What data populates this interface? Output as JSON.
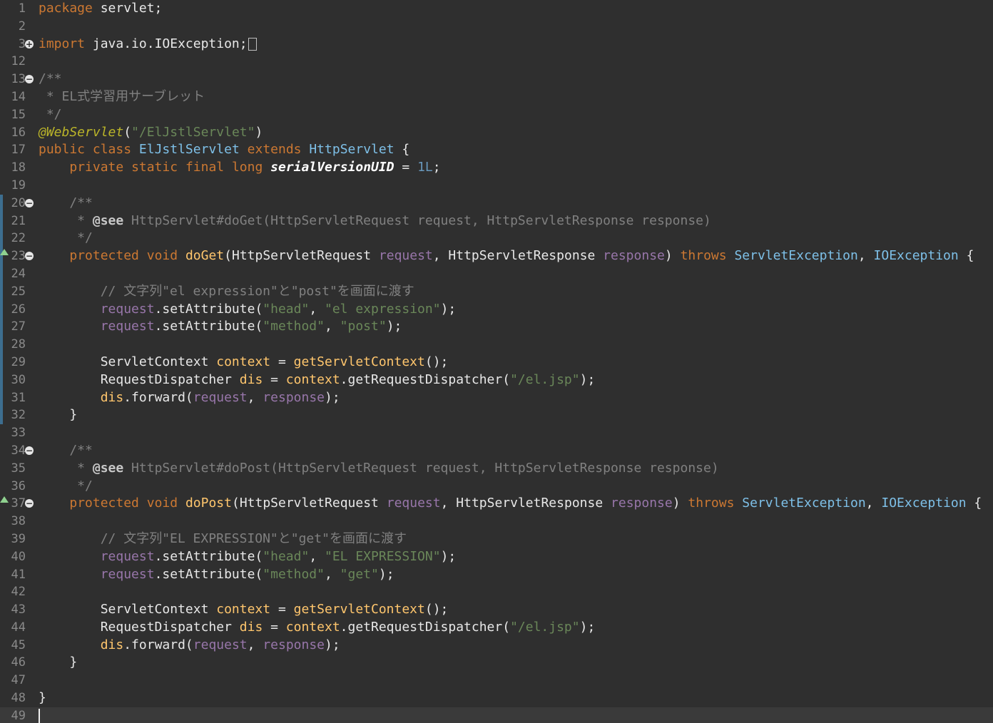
{
  "editor": {
    "lines": [
      {
        "n": "1",
        "tokens": [
          {
            "t": "package",
            "c": "kw"
          },
          {
            "t": " servlet;",
            "c": "plain"
          }
        ]
      },
      {
        "n": "2",
        "tokens": []
      },
      {
        "n": "3",
        "fold": "+",
        "tokens": [
          {
            "t": "import",
            "c": "kw"
          },
          {
            "t": " java.io.IOException;",
            "c": "plain"
          }
        ],
        "folded": true
      },
      {
        "n": "12",
        "tokens": []
      },
      {
        "n": "13",
        "fold": "-",
        "tokens": [
          {
            "t": "/**",
            "c": "cmt"
          }
        ]
      },
      {
        "n": "14",
        "tokens": [
          {
            "t": " * EL式学習用サーブレット",
            "c": "cmt"
          }
        ]
      },
      {
        "n": "15",
        "tokens": [
          {
            "t": " */",
            "c": "cmt"
          }
        ]
      },
      {
        "n": "16",
        "tokens": [
          {
            "t": "@WebServlet",
            "c": "ann"
          },
          {
            "t": "(",
            "c": "plain"
          },
          {
            "t": "\"/ElJstlServlet\"",
            "c": "str"
          },
          {
            "t": ")",
            "c": "plain"
          }
        ]
      },
      {
        "n": "17",
        "tokens": [
          {
            "t": "public",
            "c": "kw"
          },
          {
            "t": " ",
            "c": "plain"
          },
          {
            "t": "class",
            "c": "kw"
          },
          {
            "t": " ",
            "c": "plain"
          },
          {
            "t": "ElJstlServlet",
            "c": "type"
          },
          {
            "t": " ",
            "c": "plain"
          },
          {
            "t": "extends",
            "c": "kw"
          },
          {
            "t": " ",
            "c": "plain"
          },
          {
            "t": "HttpServlet",
            "c": "type"
          },
          {
            "t": " {",
            "c": "plain"
          }
        ]
      },
      {
        "n": "18",
        "tokens": [
          {
            "t": "    ",
            "c": "plain"
          },
          {
            "t": "private",
            "c": "kw"
          },
          {
            "t": " ",
            "c": "plain"
          },
          {
            "t": "static",
            "c": "kw"
          },
          {
            "t": " ",
            "c": "plain"
          },
          {
            "t": "final",
            "c": "kw"
          },
          {
            "t": " ",
            "c": "plain"
          },
          {
            "t": "long",
            "c": "kw"
          },
          {
            "t": " ",
            "c": "plain"
          },
          {
            "t": "serialVersionUID",
            "c": "fld"
          },
          {
            "t": " = ",
            "c": "plain"
          },
          {
            "t": "1L",
            "c": "num"
          },
          {
            "t": ";",
            "c": "plain"
          }
        ]
      },
      {
        "n": "19",
        "tokens": []
      },
      {
        "n": "20",
        "fold": "-",
        "changed": true,
        "tokens": [
          {
            "t": "    /**",
            "c": "cmt"
          }
        ]
      },
      {
        "n": "21",
        "changed": true,
        "tokens": [
          {
            "t": "     * ",
            "c": "cmt"
          },
          {
            "t": "@see",
            "c": "tag"
          },
          {
            "t": " HttpServlet#doGet(HttpServletRequest request, HttpServletResponse response)",
            "c": "cmt"
          }
        ]
      },
      {
        "n": "22",
        "changed": true,
        "tokens": [
          {
            "t": "     */",
            "c": "cmt"
          }
        ]
      },
      {
        "n": "23",
        "fold": "-",
        "override": true,
        "changed": true,
        "tokens": [
          {
            "t": "    ",
            "c": "plain"
          },
          {
            "t": "protected",
            "c": "kw"
          },
          {
            "t": " ",
            "c": "plain"
          },
          {
            "t": "void",
            "c": "kw"
          },
          {
            "t": " ",
            "c": "plain"
          },
          {
            "t": "doGet",
            "c": "meth"
          },
          {
            "t": "(HttpServletRequest ",
            "c": "plain"
          },
          {
            "t": "request",
            "c": "var"
          },
          {
            "t": ", HttpServletResponse ",
            "c": "plain"
          },
          {
            "t": "response",
            "c": "var"
          },
          {
            "t": ") ",
            "c": "plain"
          },
          {
            "t": "throws",
            "c": "kw"
          },
          {
            "t": " ",
            "c": "plain"
          },
          {
            "t": "ServletException",
            "c": "type"
          },
          {
            "t": ", ",
            "c": "plain"
          },
          {
            "t": "IOException",
            "c": "type"
          },
          {
            "t": " {",
            "c": "plain"
          }
        ]
      },
      {
        "n": "24",
        "changed": true,
        "tokens": []
      },
      {
        "n": "25",
        "changed": true,
        "tokens": [
          {
            "t": "        // 文字列\"el expression\"と\"post\"を画面に渡す",
            "c": "cmt"
          }
        ]
      },
      {
        "n": "26",
        "changed": true,
        "tokens": [
          {
            "t": "        ",
            "c": "plain"
          },
          {
            "t": "request",
            "c": "var"
          },
          {
            "t": ".setAttribute(",
            "c": "plain"
          },
          {
            "t": "\"head\"",
            "c": "str"
          },
          {
            "t": ", ",
            "c": "plain"
          },
          {
            "t": "\"el expression\"",
            "c": "str"
          },
          {
            "t": ");",
            "c": "plain"
          }
        ]
      },
      {
        "n": "27",
        "changed": true,
        "tokens": [
          {
            "t": "        ",
            "c": "plain"
          },
          {
            "t": "request",
            "c": "var"
          },
          {
            "t": ".setAttribute(",
            "c": "plain"
          },
          {
            "t": "\"method\"",
            "c": "str"
          },
          {
            "t": ", ",
            "c": "plain"
          },
          {
            "t": "\"post\"",
            "c": "str"
          },
          {
            "t": ");",
            "c": "plain"
          }
        ]
      },
      {
        "n": "28",
        "changed": true,
        "tokens": []
      },
      {
        "n": "29",
        "changed": true,
        "tokens": [
          {
            "t": "        ServletContext ",
            "c": "plain"
          },
          {
            "t": "context",
            "c": "meth"
          },
          {
            "t": " = ",
            "c": "plain"
          },
          {
            "t": "getServletContext",
            "c": "meth"
          },
          {
            "t": "();",
            "c": "plain"
          }
        ]
      },
      {
        "n": "30",
        "changed": true,
        "tokens": [
          {
            "t": "        RequestDispatcher ",
            "c": "plain"
          },
          {
            "t": "dis",
            "c": "meth"
          },
          {
            "t": " = ",
            "c": "plain"
          },
          {
            "t": "context",
            "c": "meth"
          },
          {
            "t": ".getRequestDispatcher(",
            "c": "plain"
          },
          {
            "t": "\"/el.jsp\"",
            "c": "str"
          },
          {
            "t": ");",
            "c": "plain"
          }
        ]
      },
      {
        "n": "31",
        "changed": true,
        "tokens": [
          {
            "t": "        ",
            "c": "plain"
          },
          {
            "t": "dis",
            "c": "meth"
          },
          {
            "t": ".forward(",
            "c": "plain"
          },
          {
            "t": "request",
            "c": "var"
          },
          {
            "t": ", ",
            "c": "plain"
          },
          {
            "t": "response",
            "c": "var"
          },
          {
            "t": ");",
            "c": "plain"
          }
        ]
      },
      {
        "n": "32",
        "changed": true,
        "tokens": [
          {
            "t": "    }",
            "c": "plain"
          }
        ]
      },
      {
        "n": "33",
        "tokens": []
      },
      {
        "n": "34",
        "fold": "-",
        "tokens": [
          {
            "t": "    /**",
            "c": "cmt"
          }
        ]
      },
      {
        "n": "35",
        "tokens": [
          {
            "t": "     * ",
            "c": "cmt"
          },
          {
            "t": "@see",
            "c": "tag"
          },
          {
            "t": " HttpServlet#doPost(HttpServletRequest request, HttpServletResponse response)",
            "c": "cmt"
          }
        ]
      },
      {
        "n": "36",
        "tokens": [
          {
            "t": "     */",
            "c": "cmt"
          }
        ]
      },
      {
        "n": "37",
        "fold": "-",
        "override": true,
        "tokens": [
          {
            "t": "    ",
            "c": "plain"
          },
          {
            "t": "protected",
            "c": "kw"
          },
          {
            "t": " ",
            "c": "plain"
          },
          {
            "t": "void",
            "c": "kw"
          },
          {
            "t": " ",
            "c": "plain"
          },
          {
            "t": "doPost",
            "c": "meth"
          },
          {
            "t": "(HttpServletRequest ",
            "c": "plain"
          },
          {
            "t": "request",
            "c": "var"
          },
          {
            "t": ", HttpServletResponse ",
            "c": "plain"
          },
          {
            "t": "response",
            "c": "var"
          },
          {
            "t": ") ",
            "c": "plain"
          },
          {
            "t": "throws",
            "c": "kw"
          },
          {
            "t": " ",
            "c": "plain"
          },
          {
            "t": "ServletException",
            "c": "type"
          },
          {
            "t": ", ",
            "c": "plain"
          },
          {
            "t": "IOException",
            "c": "type"
          },
          {
            "t": " {",
            "c": "plain"
          }
        ]
      },
      {
        "n": "38",
        "tokens": []
      },
      {
        "n": "39",
        "tokens": [
          {
            "t": "        // 文字列\"EL EXPRESSION\"と\"get\"を画面に渡す",
            "c": "cmt"
          }
        ]
      },
      {
        "n": "40",
        "tokens": [
          {
            "t": "        ",
            "c": "plain"
          },
          {
            "t": "request",
            "c": "var"
          },
          {
            "t": ".setAttribute(",
            "c": "plain"
          },
          {
            "t": "\"head\"",
            "c": "str"
          },
          {
            "t": ", ",
            "c": "plain"
          },
          {
            "t": "\"EL EXPRESSION\"",
            "c": "str"
          },
          {
            "t": ");",
            "c": "plain"
          }
        ]
      },
      {
        "n": "41",
        "tokens": [
          {
            "t": "        ",
            "c": "plain"
          },
          {
            "t": "request",
            "c": "var"
          },
          {
            "t": ".setAttribute(",
            "c": "plain"
          },
          {
            "t": "\"method\"",
            "c": "str"
          },
          {
            "t": ", ",
            "c": "plain"
          },
          {
            "t": "\"get\"",
            "c": "str"
          },
          {
            "t": ");",
            "c": "plain"
          }
        ]
      },
      {
        "n": "42",
        "tokens": []
      },
      {
        "n": "43",
        "tokens": [
          {
            "t": "        ServletContext ",
            "c": "plain"
          },
          {
            "t": "context",
            "c": "meth"
          },
          {
            "t": " = ",
            "c": "plain"
          },
          {
            "t": "getServletContext",
            "c": "meth"
          },
          {
            "t": "();",
            "c": "plain"
          }
        ]
      },
      {
        "n": "44",
        "tokens": [
          {
            "t": "        RequestDispatcher ",
            "c": "plain"
          },
          {
            "t": "dis",
            "c": "meth"
          },
          {
            "t": " = ",
            "c": "plain"
          },
          {
            "t": "context",
            "c": "meth"
          },
          {
            "t": ".getRequestDispatcher(",
            "c": "plain"
          },
          {
            "t": "\"/el.jsp\"",
            "c": "str"
          },
          {
            "t": ");",
            "c": "plain"
          }
        ]
      },
      {
        "n": "45",
        "tokens": [
          {
            "t": "        ",
            "c": "plain"
          },
          {
            "t": "dis",
            "c": "meth"
          },
          {
            "t": ".forward(",
            "c": "plain"
          },
          {
            "t": "request",
            "c": "var"
          },
          {
            "t": ", ",
            "c": "plain"
          },
          {
            "t": "response",
            "c": "var"
          },
          {
            "t": ");",
            "c": "plain"
          }
        ]
      },
      {
        "n": "46",
        "tokens": [
          {
            "t": "    }",
            "c": "plain"
          }
        ]
      },
      {
        "n": "47",
        "tokens": []
      },
      {
        "n": "48",
        "tokens": [
          {
            "t": "}",
            "c": "plain"
          }
        ]
      },
      {
        "n": "49",
        "current": true,
        "cursor": true,
        "tokens": []
      }
    ]
  },
  "colors": {
    "background": "#2f2f2f",
    "keyword": "#cc7832",
    "string": "#6a8759",
    "comment": "#808080",
    "type": "#7ec0e8",
    "change_ruler": "#3d6e8f"
  }
}
